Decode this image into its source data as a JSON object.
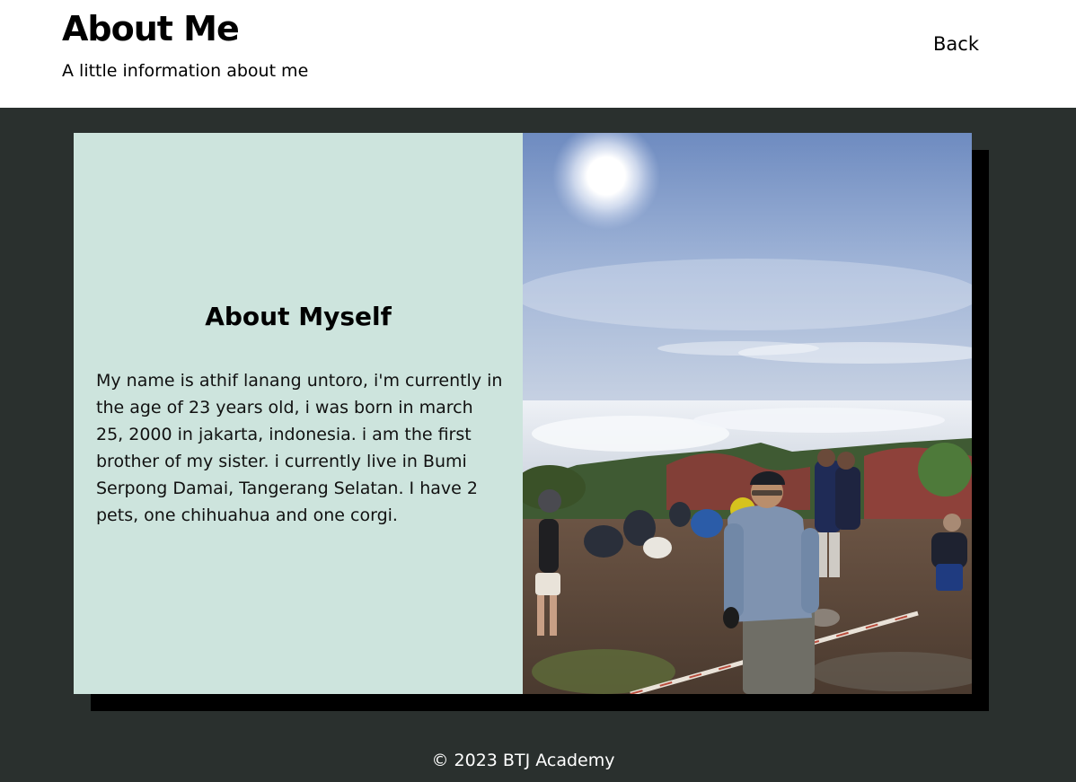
{
  "header": {
    "title": "About Me",
    "subtitle": "A little information about me",
    "back_label": "Back"
  },
  "about": {
    "heading": "About Myself",
    "bio": "My name is athif lanang untoro, i'm currently in the age of 23 years old, i was born in march 25, 2000 in jakarta, indonesia. i am the first brother of my sister. i currently live in Bumi Serpong Damai, Tangerang Selatan. I have 2 pets, one chihuahua and one corgi."
  },
  "footer": {
    "copyright": "© 2023 BTJ Academy"
  },
  "colors": {
    "page_background": "#2a302e",
    "header_background": "#ffffff",
    "text_panel": "#cde4dd",
    "card_shadow": "#000000"
  }
}
